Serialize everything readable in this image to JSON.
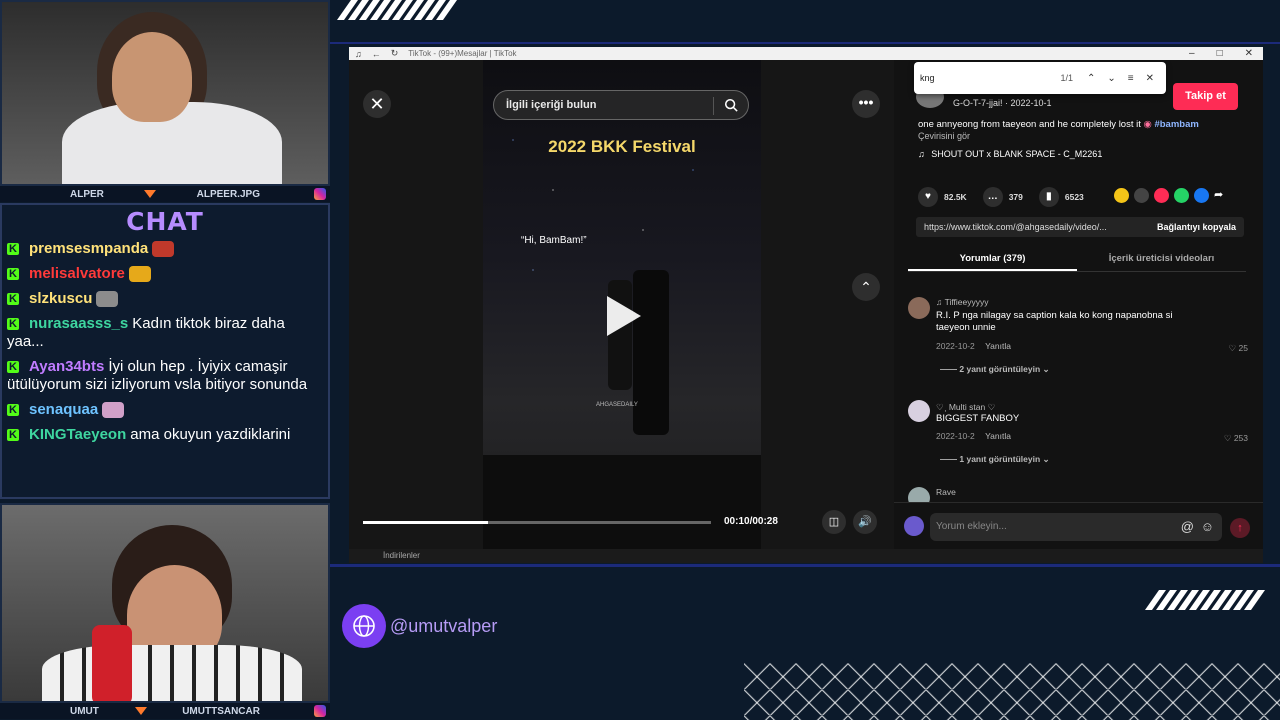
{
  "stream": {
    "cam_top": {
      "left_name": "ALPER",
      "right_name": "ALPEER.JPG"
    },
    "cam_bottom": {
      "left_name": "UMUT",
      "right_name": "UMUTTSANCAR"
    },
    "chat_title": "CHAT",
    "chat_messages": [
      {
        "user": "premsesmpanda",
        "text": "",
        "color": "#ffe27a"
      },
      {
        "user": "melisalvatore",
        "text": "",
        "color": "#ff3a3a"
      },
      {
        "user": "slzkuscu",
        "text": "",
        "color": "#ffe27a"
      },
      {
        "user": "nurasaasss_s",
        "text": "Kadın tiktok biraz daha yaa...",
        "color": "#3ed6a0"
      },
      {
        "user": "Ayan34bts",
        "text": "İyi olun hep . İyiyix camaşir ütülüyorum sizi izliyorum vsla bitiyor sonunda",
        "color": "#c07cff"
      },
      {
        "user": "senaquaa",
        "text": "",
        "color": "#6ec3ff"
      },
      {
        "user": "KINGTaeyeon",
        "text": "ama okuyun yazdiklarini",
        "color": "#3ed6a0"
      }
    ],
    "handle": "@umutvalper"
  },
  "browser": {
    "tab_title": "TikTok - (99+)Mesajlar | TikTok",
    "downloads_label": "İndirilenler",
    "find_bar": {
      "query": "kng",
      "count": "1/1"
    },
    "video": {
      "search_placeholder": "İlgili içeriği bulun",
      "title": "2022 BKK Festival",
      "quote": "“Hi, BamBam!”",
      "watermark": "AHGASEDAILY",
      "time": "00:10/00:28",
      "progress": 0.36
    },
    "post": {
      "follow_label": "Takip et",
      "author_line": "G-O-T-7-jjai! · 2022-10-1",
      "description": "one annyeong from taeyeon and he completely lost it",
      "hashtag": "#bambam",
      "translate": "Çevirisini gör",
      "music": "SHOUT OUT x BLANK SPACE - C_M2261",
      "likes": "82.5K",
      "comments": "379",
      "saves": "6523",
      "link": "https://www.tiktok.com/@ahgasedaily/video/...",
      "copy_label": "Bağlantıyı kopyala"
    },
    "tabs": [
      "Yorumlar (379)",
      "İçerik üreticisi videoları"
    ],
    "comments": [
      {
        "name": "♫ Tiffieeyyyyy",
        "text": "R.I. P nga nilagay sa caption kala ko kong napanobna si taeyeon unnie",
        "date": "2022-10-2",
        "reply": "Yanıtla",
        "likes": "25",
        "replies": "2 yanıt görüntüleyin"
      },
      {
        "name": "♡ ฺ Multi stan ♡",
        "text": "BIGGEST FANBOY",
        "date": "2022-10-2",
        "reply": "Yanıtla",
        "likes": "253",
        "replies": "1 yanıt görüntüleyin"
      },
      {
        "name": "Rave",
        "text": "",
        "date": "",
        "reply": "",
        "likes": "",
        "replies": ""
      }
    ],
    "comment_placeholder": "Yorum ekleyin..."
  },
  "icons": [
    "close-icon",
    "search-icon",
    "more-icon",
    "chevron-up-icon",
    "play-icon",
    "volume-icon",
    "pip-icon",
    "heart-icon",
    "comment-icon",
    "bookmark-icon",
    "at-icon",
    "emoji-icon",
    "send-icon",
    "globe-icon",
    "music-icon"
  ]
}
